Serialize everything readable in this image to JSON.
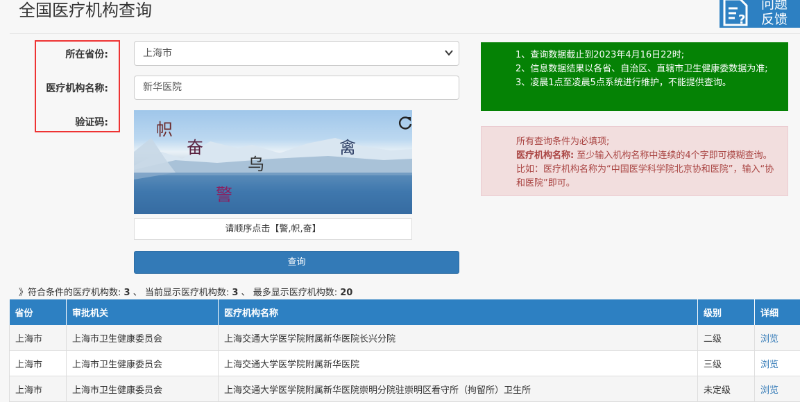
{
  "page": {
    "title": "全国医疗机构查询",
    "feedback": {
      "line1": "问题",
      "line2": "反馈"
    }
  },
  "form": {
    "province_label": "所在省份:",
    "name_label": "医疗机构名称:",
    "captcha_label": "验证码:",
    "province_value": "上海市",
    "name_value": "新华医院",
    "captcha_chars": [
      "帜",
      "奋",
      "乌",
      "禽",
      "警"
    ],
    "captcha_hint": "请顺序点击【警,帜,奋】",
    "query_label": "查询"
  },
  "notices": {
    "green": [
      "1、查询数据截止到2023年4月16日22时;",
      "2、信息数据结果以各省、自治区、直辖市卫生健康委数据为准;",
      "3、凌晨1点至凌晨5点系统进行维护，不能提供查询。"
    ],
    "red": {
      "line1": "所有查询条件为必填项;",
      "bold": "医疗机构名称:",
      "rest": "至少输入机构名称中连续的4个字即可模糊查询。比如：医疗机构名称为“中国医学科学院北京协和医院”，输入“协和医院”即可。"
    }
  },
  "summary": {
    "prefix": "》符合条件的医疗机构数:",
    "match_count": "3",
    "sep1": "、 当前显示医疗机构数:",
    "shown_count": "3",
    "sep2": "、 最多显示医疗机构数:",
    "max_count": "20"
  },
  "table": {
    "headers": [
      "省份",
      "审批机关",
      "医疗机构名称",
      "级别",
      "详细"
    ],
    "rows": [
      [
        "上海市",
        "上海市卫生健康委员会",
        "上海交通大学医学院附属新华医院长兴分院",
        "二级",
        "浏览"
      ],
      [
        "上海市",
        "上海市卫生健康委员会",
        "上海交通大学医学院附属新华医院",
        "三级",
        "浏览"
      ],
      [
        "上海市",
        "上海市卫生健康委员会",
        "上海交通大学医学院附属新华医院崇明分院驻崇明区看守所（拘留所）卫生所",
        "未定级",
        "浏览"
      ]
    ]
  },
  "colors": {
    "primary": "#337ab7",
    "header": "#2d80c2",
    "success": "#058205",
    "danger_bg": "#f2dede",
    "danger_text": "#a94442",
    "highlight_border": "#ee3333"
  }
}
